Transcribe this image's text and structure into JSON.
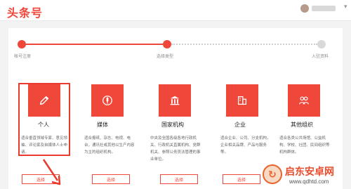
{
  "header": {
    "logo_text": "头条号"
  },
  "steps": [
    {
      "label": "帐号注册",
      "state": "done"
    },
    {
      "label": "选择类型",
      "state": "current"
    },
    {
      "label": "入驻资料",
      "state": "todo"
    }
  ],
  "types": [
    {
      "name": "个人",
      "icon": "pen-icon",
      "description": "适合垂直领域专家、意见领袖、评论家及自媒体人士申请。",
      "button": "选择",
      "selected": true
    },
    {
      "name": "媒体",
      "icon": "microphone-icon",
      "description": "适合报纸、杂志、电视、电台，通讯社或其他以生产内容为主的组织机构。",
      "button": "选择"
    },
    {
      "name": "国家机构",
      "icon": "government-building-icon",
      "description": "中央及全国各级各地行政机关、行政机关直属机构、党群机关、参照公务员法管理的事业单位。",
      "button": "选择"
    },
    {
      "name": "企业",
      "icon": "office-building-icon",
      "description": "适合企业、公司、分支机构，企业相关品牌、产品与服务等。",
      "button": "选择"
    },
    {
      "name": "其他组织",
      "icon": "people-group-icon",
      "description": "适合各类公共场馆、公益机构、学校、社团、民间组织等机构群体。",
      "button": "选择"
    }
  ],
  "watermark": {
    "title": "启东安卓网",
    "url": "www.qdhtd.com"
  },
  "colors": {
    "accent": "#f0473b",
    "highlight": "#e83a2e"
  }
}
